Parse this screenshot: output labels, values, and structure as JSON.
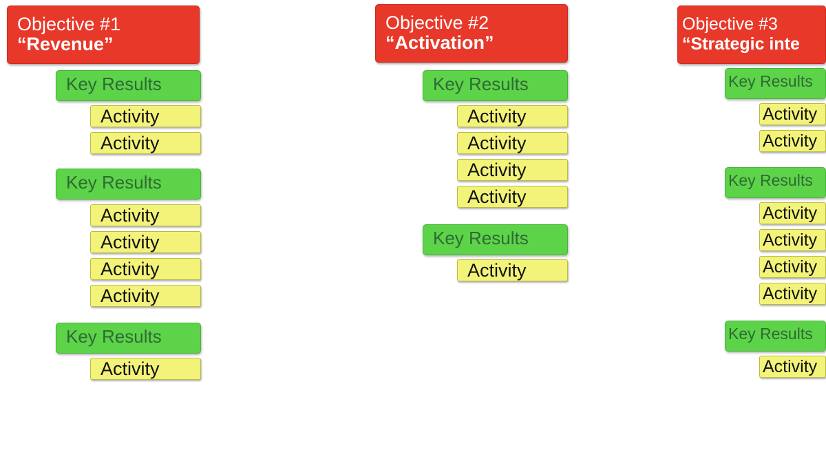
{
  "colors": {
    "objective": "#e8382a",
    "key_result": "#5dd34a",
    "activity": "#f3f37a"
  },
  "columns": [
    {
      "objective": {
        "line1": "Objective #1",
        "line2": "“Revenue”"
      },
      "groups": [
        {
          "key_result": "Key Results",
          "activities": [
            "Activity",
            "Activity"
          ]
        },
        {
          "key_result": "Key Results",
          "activities": [
            "Activity",
            "Activity",
            "Activity",
            "Activity"
          ]
        },
        {
          "key_result": "Key Results",
          "activities": [
            "Activity"
          ]
        }
      ]
    },
    {
      "objective": {
        "line1": "Objective #2",
        "line2": "“Activation”"
      },
      "groups": [
        {
          "key_result": "Key Results",
          "activities": [
            "Activity",
            "Activity",
            "Activity",
            "Activity"
          ]
        },
        {
          "key_result": "Key Results",
          "activities": [
            "Activity"
          ]
        }
      ]
    },
    {
      "objective": {
        "line1": "Objective #3",
        "line2": "“Strategic inte"
      },
      "groups": [
        {
          "key_result": "Key Results",
          "activities": [
            "Activity",
            "Activity"
          ]
        },
        {
          "key_result": "Key Results",
          "activities": [
            "Activity",
            "Activity",
            "Activity",
            "Activity"
          ]
        },
        {
          "key_result": "Key Results",
          "activities": [
            "Activity"
          ]
        }
      ]
    }
  ]
}
